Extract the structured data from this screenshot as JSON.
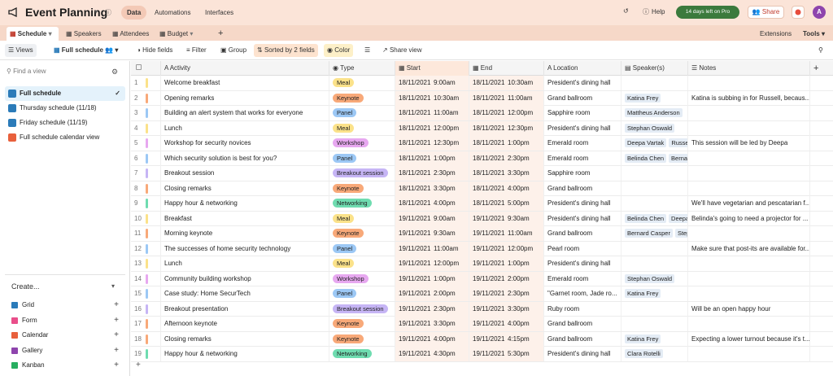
{
  "app": {
    "name": "Event Planning",
    "nav": [
      "Data",
      "Automations",
      "Interfaces"
    ],
    "help": "Help",
    "pro_badge": "14 days left on Pro",
    "share": "Share",
    "avatar": "A"
  },
  "tabs": [
    "Schedule",
    "Speakers",
    "Attendees",
    "Budget"
  ],
  "tabbar_right": {
    "extensions": "Extensions",
    "tools": "Tools"
  },
  "toolbar": {
    "views": "Views",
    "view_name": "Full schedule",
    "hide": "Hide fields",
    "filter": "Filter",
    "group": "Group",
    "sort": "Sorted by 2 fields",
    "color": "Color",
    "share": "Share view"
  },
  "sidebar": {
    "find_placeholder": "Find a view",
    "views": [
      "Full schedule",
      "Thursday schedule (11/18)",
      "Friday schedule (11/19)",
      "Full schedule calendar view"
    ],
    "create_label": "Create...",
    "create_items": [
      "Grid",
      "Form",
      "Calendar",
      "Gallery",
      "Kanban"
    ]
  },
  "columns": [
    "Activity",
    "Type",
    "Start",
    "End",
    "Location",
    "Speaker(s)",
    "Notes"
  ],
  "type_colors": {
    "Meal": "#fbe28a",
    "Keynote": "#f8a979",
    "Panel": "#9cc8f5",
    "Workshop": "#e7a8f0",
    "Breakout session": "#c6b5f5",
    "Networking": "#6fdcb0"
  },
  "rows": [
    {
      "n": "1",
      "activity": "Welcome breakfast",
      "type": "Meal",
      "sd": "18/11/2021",
      "st": "9:00am",
      "ed": "18/11/2021",
      "et": "10:30am",
      "loc": "President's dining hall",
      "sp": [],
      "notes": ""
    },
    {
      "n": "2",
      "activity": "Opening remarks",
      "type": "Keynote",
      "sd": "18/11/2021",
      "st": "10:30am",
      "ed": "18/11/2021",
      "et": "11:00am",
      "loc": "Grand ballroom",
      "sp": [
        "Katina Frey"
      ],
      "notes": "Katina is subbing in for Russell, becaus..."
    },
    {
      "n": "3",
      "activity": "Building an alert system that works for everyone",
      "type": "Panel",
      "sd": "18/11/2021",
      "st": "11:00am",
      "ed": "18/11/2021",
      "et": "12:00pm",
      "loc": "Sapphire room",
      "sp": [
        "Mattheus Anderson"
      ],
      "notes": ""
    },
    {
      "n": "4",
      "activity": "Lunch",
      "type": "Meal",
      "sd": "18/11/2021",
      "st": "12:00pm",
      "ed": "18/11/2021",
      "et": "12:30pm",
      "loc": "President's dining hall",
      "sp": [
        "Stephan Oswald"
      ],
      "notes": ""
    },
    {
      "n": "5",
      "activity": "Workshop for security novices",
      "type": "Workshop",
      "sd": "18/11/2021",
      "st": "12:30pm",
      "ed": "18/11/2021",
      "et": "1:00pm",
      "loc": "Emerald room",
      "sp": [
        "Deepa Vartak",
        "Russell"
      ],
      "notes": "This session will be led by Deepa"
    },
    {
      "n": "6",
      "activity": "Which security solution is best for you?",
      "type": "Panel",
      "sd": "18/11/2021",
      "st": "1:00pm",
      "ed": "18/11/2021",
      "et": "2:30pm",
      "loc": "Emerald room",
      "sp": [
        "Belinda Chen",
        "Bernard"
      ],
      "notes": ""
    },
    {
      "n": "7",
      "activity": "Breakout session",
      "type": "Breakout session",
      "sd": "18/11/2021",
      "st": "2:30pm",
      "ed": "18/11/2021",
      "et": "3:30pm",
      "loc": "Sapphire room",
      "sp": [],
      "notes": ""
    },
    {
      "n": "8",
      "activity": "Closing remarks",
      "type": "Keynote",
      "sd": "18/11/2021",
      "st": "3:30pm",
      "ed": "18/11/2021",
      "et": "4:00pm",
      "loc": "Grand ballroom",
      "sp": [],
      "notes": ""
    },
    {
      "n": "9",
      "activity": "Happy hour & networking",
      "type": "Networking",
      "sd": "18/11/2021",
      "st": "4:00pm",
      "ed": "18/11/2021",
      "et": "5:00pm",
      "loc": "President's dining hall",
      "sp": [],
      "notes": "We'll have vegetarian and pescatarian f..."
    },
    {
      "n": "10",
      "activity": "Breakfast",
      "type": "Meal",
      "sd": "19/11/2021",
      "st": "9:00am",
      "ed": "19/11/2021",
      "et": "9:30am",
      "loc": "President's dining hall",
      "sp": [
        "Belinda Chen",
        "Deepa"
      ],
      "notes": "Belinda's going to need a projector for ..."
    },
    {
      "n": "11",
      "activity": "Morning keynote",
      "type": "Keynote",
      "sd": "19/11/2021",
      "st": "9:30am",
      "ed": "19/11/2021",
      "et": "11:00am",
      "loc": "Grand ballroom",
      "sp": [
        "Bernard Casper",
        "Step"
      ],
      "notes": ""
    },
    {
      "n": "12",
      "activity": "The successes of home security technology",
      "type": "Panel",
      "sd": "19/11/2021",
      "st": "11:00am",
      "ed": "19/11/2021",
      "et": "12:00pm",
      "loc": "Pearl room",
      "sp": [],
      "notes": "Make sure that post-its are available for..."
    },
    {
      "n": "13",
      "activity": "Lunch",
      "type": "Meal",
      "sd": "19/11/2021",
      "st": "12:00pm",
      "ed": "19/11/2021",
      "et": "1:00pm",
      "loc": "President's dining hall",
      "sp": [],
      "notes": ""
    },
    {
      "n": "14",
      "activity": "Community building workshop",
      "type": "Workshop",
      "sd": "19/11/2021",
      "st": "1:00pm",
      "ed": "19/11/2021",
      "et": "2:00pm",
      "loc": "Emerald room",
      "sp": [
        "Stephan Oswald"
      ],
      "notes": ""
    },
    {
      "n": "15",
      "activity": "Case study: Home SecurTech",
      "type": "Panel",
      "sd": "19/11/2021",
      "st": "2:00pm",
      "ed": "19/11/2021",
      "et": "2:30pm",
      "loc": "\"Garnet room, Jade ro...",
      "sp": [
        "Katina Frey"
      ],
      "notes": ""
    },
    {
      "n": "16",
      "activity": "Breakout presentation",
      "type": "Breakout session",
      "sd": "19/11/2021",
      "st": "2:30pm",
      "ed": "19/11/2021",
      "et": "3:30pm",
      "loc": "Ruby room",
      "sp": [],
      "notes": "Will be an open happy hour"
    },
    {
      "n": "17",
      "activity": "Afternoon keynote",
      "type": "Keynote",
      "sd": "19/11/2021",
      "st": "3:30pm",
      "ed": "19/11/2021",
      "et": "4:00pm",
      "loc": "Grand ballroom",
      "sp": [],
      "notes": ""
    },
    {
      "n": "18",
      "activity": "Closing remarks",
      "type": "Keynote",
      "sd": "19/11/2021",
      "st": "4:00pm",
      "ed": "19/11/2021",
      "et": "4:15pm",
      "loc": "Grand ballroom",
      "sp": [
        "Katina Frey"
      ],
      "notes": "Expecting a lower turnout because it's t..."
    },
    {
      "n": "19",
      "activity": "Happy hour & networking",
      "type": "Networking",
      "sd": "19/11/2021",
      "st": "4:30pm",
      "ed": "19/11/2021",
      "et": "5:30pm",
      "loc": "President's dining hall",
      "sp": [
        "Clara Rotelli"
      ],
      "notes": ""
    }
  ]
}
